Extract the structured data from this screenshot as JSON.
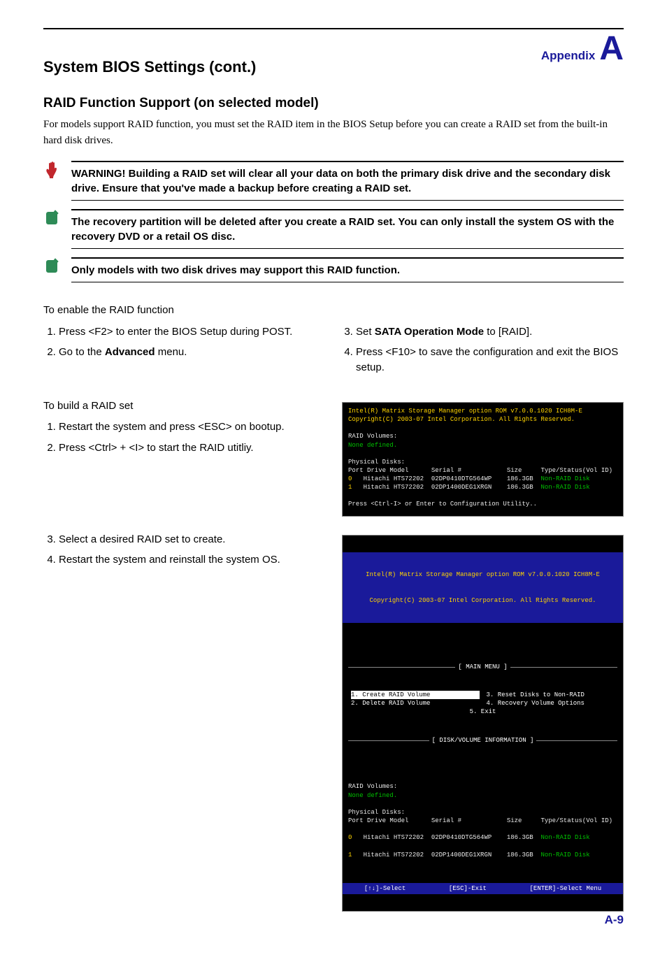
{
  "header": {
    "label": "Appendix",
    "letter": "A"
  },
  "title": "System BIOS Settings (cont.)",
  "h2": "RAID Function Support (on selected model)",
  "intro": "For models support RAID function, you must set the RAID item in the BIOS Setup before you can create a RAID set from the built-in hard disk drives.",
  "notes": [
    {
      "icon": "warn",
      "text": "WARNING! Building a RAID set will clear all your data on both the primary disk drive and the secondary disk drive. Ensure that you've made a backup before creating a RAID set."
    },
    {
      "icon": "pencil",
      "text": "The recovery partition will be deleted after you create a RAID set. You can only install the system OS with the recovery DVD or a retail OS disc."
    },
    {
      "icon": "pencil",
      "text": "Only models with two disk drives may support this RAID function."
    }
  ],
  "enable": {
    "lead": "To enable the RAID function",
    "s1": "Press <F2> to enter the BIOS Setup during POST.",
    "s2a": "Go to the ",
    "s2b": "Advanced",
    "s2c": " menu.",
    "s3a": "Set ",
    "s3b": "SATA Operation Mode",
    "s3c": " to [RAID].",
    "s4": "Press <F10> to save the configuration and exit the BIOS setup."
  },
  "build": {
    "lead": "To build a RAID set",
    "s1": "Restart the system and press <ESC> on bootup.",
    "s2": "Press <Ctrl> + <I> to start the RAID utitliy.",
    "s3": "Select a desired RAID set to create.",
    "s4": "Restart the system and reinstall the system OS."
  },
  "term1": {
    "l1": "Intel(R) Matrix Storage Manager option ROM v7.0.0.1020 ICH8M-E",
    "l2": "Copyright(C) 2003-07 Intel Corporation. All Rights Reserved.",
    "l3": "RAID Volumes:",
    "l4": "None defined.",
    "l5": "Physical Disks:",
    "l6": "Port Drive Model      Serial #            Size     Type/Status(Vol ID)",
    "r0p": "0   ",
    "r0m": "Hitachi HTS72202  02DP0410DTG564WP    186.3GB  ",
    "r0s": "Non-RAID Disk",
    "r1p": "1   ",
    "r1m": "Hitachi HTS72202  02DP1400DEG1XRGN    186.3GB  ",
    "r1s": "Non-RAID Disk",
    "l9": "Press <Ctrl-I> or Enter to Configuration Utility.."
  },
  "term2": {
    "hl1": "Intel(R) Matrix Storage Manager option ROM v7.0.0.1020 ICH8M-E",
    "hl2": "Copyright(C) 2003-07 Intel Corporation. All Rights Reserved.",
    "mainLabel": "[ MAIN MENU ]",
    "m1": "1. Create RAID Volume",
    "m2": "2. Delete RAID Volume",
    "m3": "3. Reset Disks to Non-RAID",
    "m4": "4. Recovery Volume Options",
    "m5": "5. Exit",
    "diskLabel": "[ DISK/VOLUME INFORMATION ]",
    "rvol": "RAID Volumes:",
    "none": "None defined.",
    "pd": "Physical Disks:",
    "hdr": "Port Drive Model      Serial #            Size     Type/Status(Vol ID)",
    "r0p": "0   ",
    "r0m": "Hitachi HTS72202  02DP0410DTG564WP    186.3GB  ",
    "r0s": "Non-RAID Disk",
    "r1p": "1   ",
    "r1m": "Hitachi HTS72202  02DP1400DEG1XRGN    186.3GB  ",
    "r1s": "Non-RAID Disk",
    "f1": "[↑↓]-Select",
    "f2": "[ESC]-Exit",
    "f3": "[ENTER]-Select Menu"
  },
  "footer": "A-9"
}
